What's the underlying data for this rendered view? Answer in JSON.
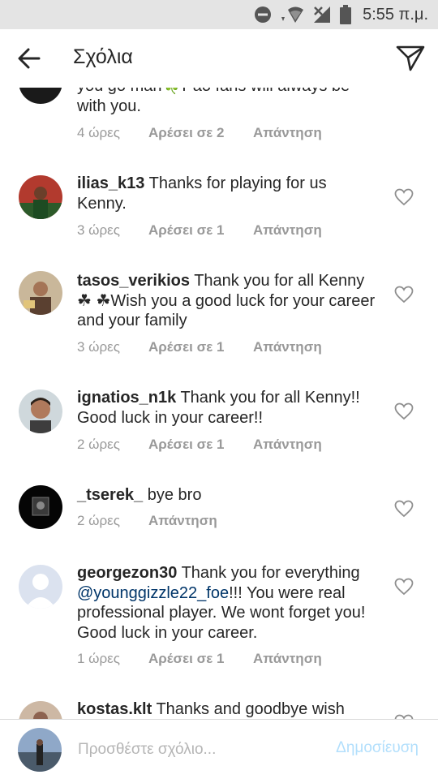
{
  "status_bar": {
    "time": "5:55 π.μ.",
    "icons": [
      "dnd-icon",
      "wifi-icon",
      "signal-icon",
      "battery-icon"
    ]
  },
  "header": {
    "title": "Σχόλια",
    "back_icon": "arrow-left-icon",
    "share_icon": "paper-plane-icon"
  },
  "comments": [
    {
      "username": "",
      "text": "you go man🍀Pao fans will always be with you.",
      "time": "4 ώρες",
      "likes": "Αρέσει σε 2",
      "reply": "Απάντηση",
      "liked": false
    },
    {
      "username": "ilias_k13",
      "text": "Thanks for playing for us Kenny.",
      "time": "3 ώρες",
      "likes": "Αρέσει σε 1",
      "reply": "Απάντηση"
    },
    {
      "username": "tasos_verikios",
      "text": "Thank you for all Kenny☘ ☘Wish you a good luck for your career and your family",
      "time": "3 ώρες",
      "likes": "Αρέσει σε 1",
      "reply": "Απάντηση"
    },
    {
      "username": "ignatios_n1k",
      "text": "Thank you for all Kenny!! Good luck in your career!!",
      "time": "2 ώρες",
      "likes": "Αρέσει σε 1",
      "reply": "Απάντηση"
    },
    {
      "username": "_tserek_",
      "text": "bye bro",
      "time": "2 ώρες",
      "likes": "",
      "reply": "Απάντηση"
    },
    {
      "username": "georgezon30",
      "text": "Thank you for everything",
      "mention": "@younggizzle22_foe",
      "text_after": "!!! You were real professional player. We wont forget you! Good luck in your career.",
      "time": "1 ώρες",
      "likes": "Αρέσει σε 1",
      "reply": "Απάντηση"
    },
    {
      "username": "kostas.klt",
      "text": "Thanks and goodbye wish",
      "time": "",
      "likes": "",
      "reply": ""
    }
  ],
  "composer": {
    "placeholder": "Προσθέστε σχόλιο...",
    "post_label": "Δημοσίευση"
  },
  "colors": {
    "meta": "#999999",
    "mention": "#003569",
    "post_disabled": "#b2dffc",
    "status_bar_bg": "#e4e4e4"
  }
}
